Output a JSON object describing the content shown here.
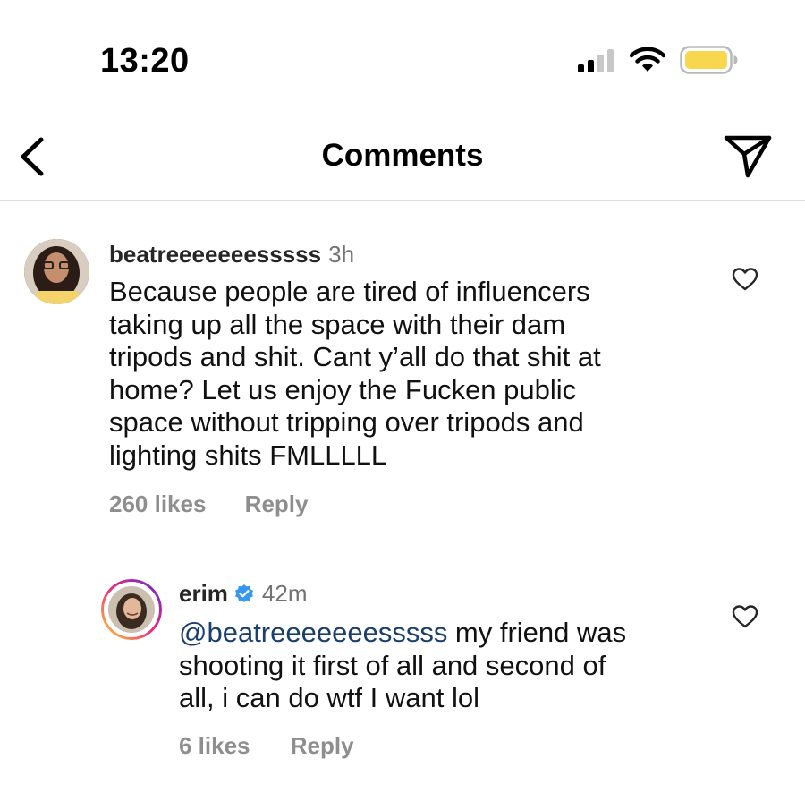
{
  "status_bar": {
    "time": "13:20",
    "signal_bars_active": 2,
    "battery_color": "#f8d64e"
  },
  "header": {
    "title": "Comments",
    "back_icon": "chevron-left-icon",
    "share_icon": "paper-plane-icon"
  },
  "comments": [
    {
      "username": "beatreeeeeeesssss",
      "time": "3h",
      "text_lines": [
        "Because people are tired of influencers",
        "taking up all the space with their dam",
        "tripods and shit. Cant y’all do that shit at",
        "home? Let us enjoy the Fucken public",
        "space without tripping over tripods and",
        "lighting shits FMLLLLL"
      ],
      "likes": "260 likes",
      "reply_label": "Reply"
    },
    {
      "username": "erim",
      "verified": true,
      "time": "42m",
      "mention": "@beatreeeeeeesssss",
      "text_first_rest": " my friend was",
      "text_lines": [
        "shooting it first of all and second of",
        "all, i can do wtf I want lol"
      ],
      "likes": "6 likes",
      "reply_label": "Reply"
    }
  ],
  "colors": {
    "verified_blue": "#3797f0",
    "mention_blue": "#1a3e6e",
    "story_ring": [
      "#f9ce34",
      "#ee2a7b",
      "#6228d7"
    ]
  }
}
